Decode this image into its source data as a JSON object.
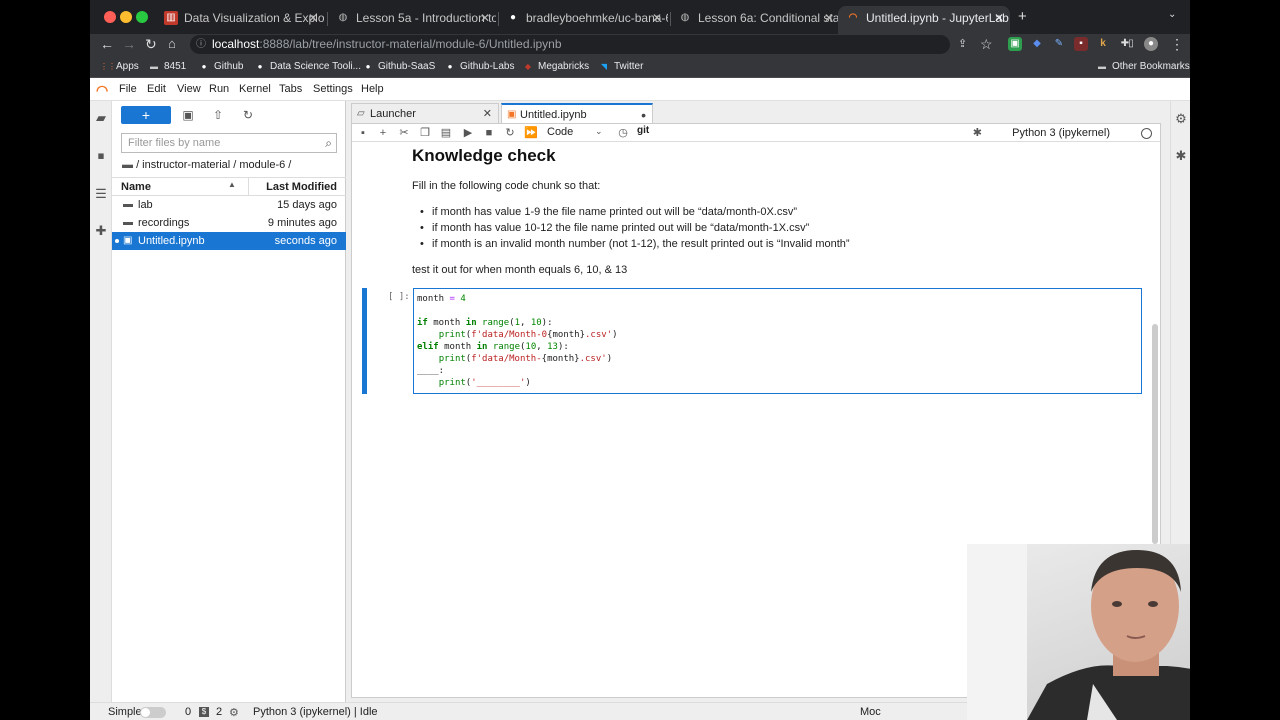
{
  "browser": {
    "tabs": [
      {
        "label": "Data Visualization & Exploratio",
        "active": false
      },
      {
        "label": "Lesson 5a - Introduction to gg",
        "active": false
      },
      {
        "label": "bradleyboehmke/uc-bana-604",
        "active": false
      },
      {
        "label": "Lesson 6a: Conditional statem",
        "active": false
      },
      {
        "label": "Untitled.ipynb - JupyterLab",
        "active": true
      }
    ],
    "url_host": "localhost",
    "url_path": ":8888/lab/tree/instructor-material/module-6/Untitled.ipynb",
    "bookmarks": [
      "Apps",
      "8451",
      "Github",
      "Data Science Tooli...",
      "Github-SaaS",
      "Github-Labs",
      "Megabricks",
      "Twitter"
    ],
    "other_bookmarks": "Other Bookmarks"
  },
  "jupyter": {
    "menu": [
      "File",
      "Edit",
      "View",
      "Run",
      "Kernel",
      "Tabs",
      "Settings",
      "Help"
    ],
    "filebrowser": {
      "filter_placeholder": "Filter files by name",
      "breadcrumb": "/ instructor-material / module-6 /",
      "col_name": "Name",
      "col_modified": "Last Modified",
      "rows": [
        {
          "name": "lab",
          "modified": "15 days ago",
          "type": "folder"
        },
        {
          "name": "recordings",
          "modified": "9 minutes ago",
          "type": "folder"
        },
        {
          "name": "Untitled.ipynb",
          "modified": "seconds ago",
          "type": "notebook"
        }
      ]
    },
    "doc_tabs": [
      "Launcher",
      "Untitled.ipynb"
    ],
    "toolbar": {
      "cell_type": "Code",
      "git": "git",
      "kernel": "Python 3 (ipykernel)"
    },
    "markdown": {
      "heading": "Knowledge check",
      "intro": "Fill in the following code chunk so that:",
      "bullets": [
        "if month has value 1-9 the file name printed out will be “data/month-0X.csv”",
        "if month has value 10-12 the file name printed out will be “data/month-1X.csv”",
        "if month is an invalid month number (not 1-12), the result printed out is “Invalid month”"
      ],
      "outro": "test it out for when month equals 6, 10, & 13"
    },
    "code_cell": {
      "prompt": "[ ]:"
    },
    "status": {
      "mode_label": "Simple",
      "terminals": "0",
      "kernels": "2",
      "kernel_status": "Python 3 (ipykernel) | Idle",
      "mode_partial": "Moc"
    }
  },
  "colors": {
    "accent": "#1976d2",
    "jupyter_orange": "#f37626",
    "browser_dark": "#202124"
  }
}
